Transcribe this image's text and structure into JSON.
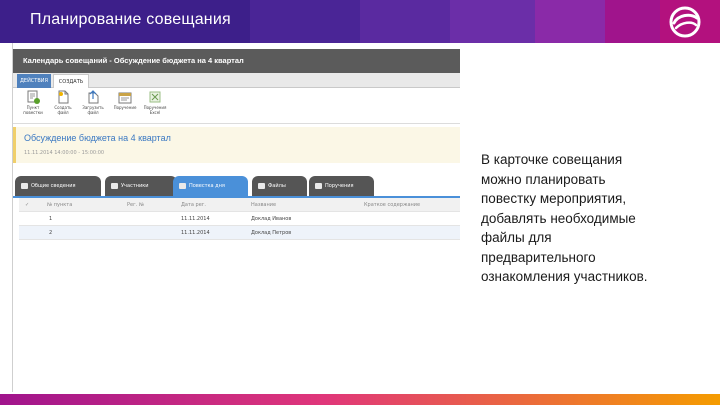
{
  "slide": {
    "title": "Планирование совещания",
    "description_lines": [
      "В карточке совещания",
      "можно планировать",
      "повестку мероприятия,",
      "добавлять необходимые",
      "файлы для",
      "предварительного",
      "ознакомления участников."
    ]
  },
  "app": {
    "window_title": "Календарь совещаний - Обсуждение бюджета на 4 квартал",
    "ribbon_tabs": [
      "Действия",
      "Создать"
    ],
    "ribbon_buttons": [
      {
        "label": "Пункт повестки",
        "icon": "agenda-item-icon"
      },
      {
        "label": "Создать файл",
        "icon": "new-file-icon"
      },
      {
        "label": "Загрузить файл",
        "icon": "upload-file-icon"
      },
      {
        "label": "Поручение",
        "icon": "assignment-icon"
      },
      {
        "label": "Поручения Excel",
        "icon": "excel-icon"
      }
    ],
    "document": {
      "title": "Обсуждение бюджета на 4 квартал",
      "subtitle": "11.11.2014  14:00:00 - 15:00:00"
    },
    "tabs": [
      {
        "label": "Общие сведения",
        "active": false
      },
      {
        "label": "Участники",
        "active": false
      },
      {
        "label": "Повестка дня",
        "active": true
      },
      {
        "label": "Файлы",
        "active": false
      },
      {
        "label": "Поручения",
        "active": false
      }
    ],
    "grid": {
      "columns": [
        "✓",
        "№ пункта",
        "Рег. №",
        "Дата рег.",
        "Название",
        "Краткое содержание"
      ],
      "rows": [
        [
          "",
          "1",
          "",
          "11.11.2014",
          "Доклад Иванов",
          ""
        ],
        [
          "",
          "2",
          "",
          "11.11.2014",
          "Доклад Петров",
          ""
        ]
      ]
    }
  },
  "colors": {
    "header": "#3d1f8a",
    "accent_magenta": "#a0148c",
    "accent_orange": "#f59c00",
    "tab_active": "#4a90d9",
    "tab_inactive": "#555555"
  }
}
